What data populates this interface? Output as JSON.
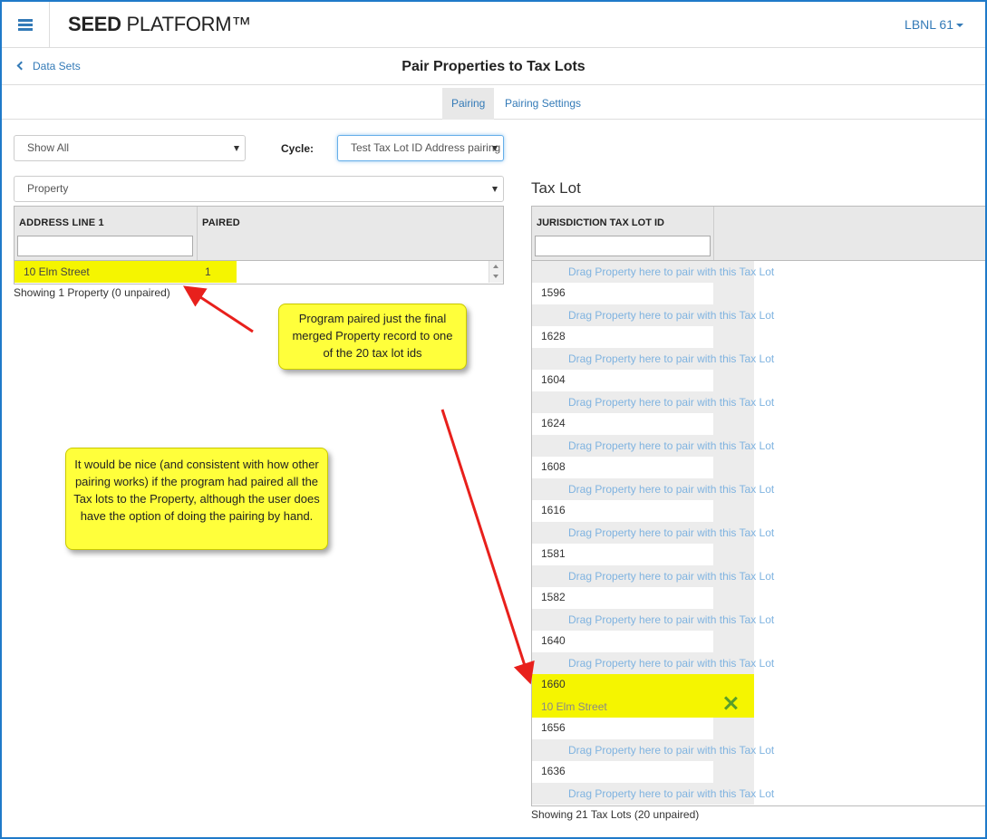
{
  "header": {
    "brand_bold": "SEED",
    "brand_rest": " PLATFORM™",
    "org_label": "LBNL 61"
  },
  "subheader": {
    "back_label": "Data Sets",
    "title": "Pair Properties to Tax Lots"
  },
  "tabs": [
    {
      "label": "Pairing",
      "active": true
    },
    {
      "label": "Pairing Settings",
      "active": false
    }
  ],
  "filters": {
    "show_select": "Show All",
    "cycle_label": "Cycle:",
    "cycle_select": "Test Tax Lot ID Address pairing",
    "inventory_select": "Property"
  },
  "property_grid": {
    "columns": [
      "ADDRESS LINE 1",
      "PAIRED"
    ],
    "rows": [
      {
        "address_line_1": "10 Elm Street",
        "paired": "1"
      }
    ],
    "status": "Showing 1 Property (0 unpaired)"
  },
  "taxlot_section": {
    "title": "Tax Lot",
    "column": "JURISDICTION TAX LOT ID",
    "first_drop_hint": "Drag Property here to pair with this Tax Lot",
    "rows": [
      {
        "id": "1596",
        "hint": "Drag Property here to pair with this Tax Lot"
      },
      {
        "id": "1628",
        "hint": "Drag Property here to pair with this Tax Lot"
      },
      {
        "id": "1604",
        "hint": "Drag Property here to pair with this Tax Lot"
      },
      {
        "id": "1624",
        "hint": "Drag Property here to pair with this Tax Lot"
      },
      {
        "id": "1608",
        "hint": "Drag Property here to pair with this Tax Lot"
      },
      {
        "id": "1616",
        "hint": "Drag Property here to pair with this Tax Lot"
      },
      {
        "id": "1581",
        "hint": "Drag Property here to pair with this Tax Lot"
      },
      {
        "id": "1582",
        "hint": "Drag Property here to pair with this Tax Lot"
      },
      {
        "id": "1640",
        "hint": "Drag Property here to pair with this Tax Lot"
      },
      {
        "id": "1660",
        "paired_with": "10 Elm Street"
      },
      {
        "id": "1656",
        "hint": "Drag Property here to pair with this Tax Lot"
      },
      {
        "id": "1636",
        "hint": "Drag Property here to pair with this Tax Lot"
      }
    ],
    "status": "Showing 21 Tax Lots (20 unpaired)"
  },
  "callouts": {
    "top": "Program paired just the final merged Property record to one of the 20 tax lot ids",
    "left": "It would be nice (and consistent with how other pairing works) if the program had paired all the Tax lots to the Property, although the user does have the option of doing the pairing by hand."
  },
  "colors": {
    "accent": "#337ab7",
    "highlight": "#f5f500",
    "callout": "#ffff3b",
    "arrow": "#e8201c",
    "unpair": "#5a9e2a"
  }
}
